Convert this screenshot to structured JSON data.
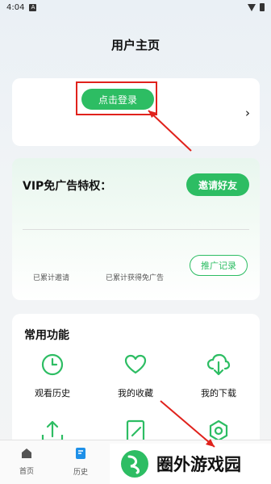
{
  "status_bar": {
    "time": "4:04",
    "notification_icon": "A"
  },
  "header": {
    "title": "用户主页"
  },
  "login_card": {
    "login_label": "点击登录"
  },
  "vip_card": {
    "title": "VIP免广告特权：",
    "invite_label": "邀请好友",
    "stat_invited_label": "已累计邀请",
    "stat_adfree_label": "已累计获得免广告",
    "record_label": "推广记录"
  },
  "functions": {
    "title": "常用功能",
    "items": [
      {
        "label": "观看历史",
        "icon": "clock-icon"
      },
      {
        "label": "我的收藏",
        "icon": "heart-icon"
      },
      {
        "label": "我的下载",
        "icon": "cloud-download-icon"
      },
      {
        "label": "",
        "icon": "upload-icon"
      },
      {
        "label": "",
        "icon": "edit-icon"
      },
      {
        "label": "",
        "icon": "settings-icon"
      }
    ]
  },
  "tabbar": {
    "home_label": "首页",
    "history_label": "历史"
  },
  "watermark": {
    "text": "圈外游戏园"
  },
  "colors": {
    "accent": "#2dbd63",
    "annotation": "#e0221c"
  }
}
